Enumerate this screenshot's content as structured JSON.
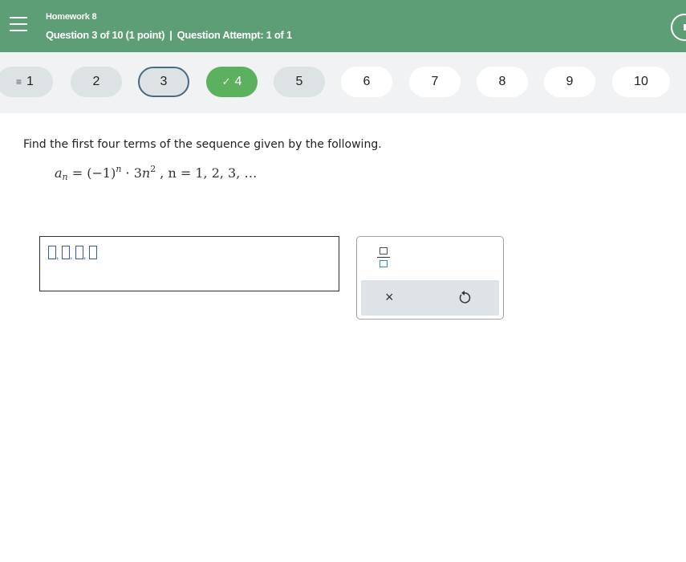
{
  "header": {
    "assignment_title": "Homework 8",
    "question_label": "Question 3 of 10 (1 point)",
    "separator": "|",
    "attempt_label": "Question Attempt: 1 of 1"
  },
  "question_nav": {
    "items": [
      {
        "label": "1",
        "state": "visited"
      },
      {
        "label": "2",
        "state": "visited"
      },
      {
        "label": "3",
        "state": "current"
      },
      {
        "label": "4",
        "state": "done"
      },
      {
        "label": "5",
        "state": "visited"
      },
      {
        "label": "6",
        "state": "unvisited"
      },
      {
        "label": "7",
        "state": "unvisited"
      },
      {
        "label": "8",
        "state": "unvisited"
      },
      {
        "label": "9",
        "state": "unvisited"
      },
      {
        "label": "10",
        "state": "unvisited"
      }
    ]
  },
  "question": {
    "prompt": "Find the first four terms of the sequence given by the following.",
    "formula": {
      "lhs_var": "a",
      "lhs_sub": "n",
      "eq": "=",
      "base": "(−1)",
      "exp": "n",
      "dot": "·",
      "coef": "3",
      "var": "n",
      "power": "2",
      "domain": ",  n = 1, 2, 3, …"
    }
  },
  "answer": {
    "slot_count": 4,
    "separator": ","
  },
  "toolbox": {
    "clear_symbol": "×"
  },
  "colors": {
    "header_bg": "#5e9e76",
    "nav_bg": "#f0f2f3",
    "done_green": "#5cb15f",
    "current_border": "#4a6a7f",
    "slot_blue": "#3a5aa8"
  }
}
